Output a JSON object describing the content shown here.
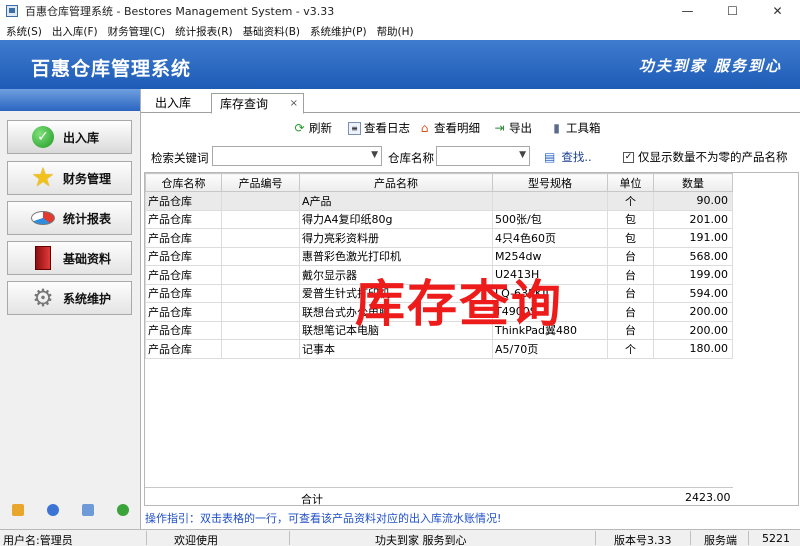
{
  "window": {
    "title": "百惠仓库管理系统 - Bestores Management System - v3.33",
    "minimize": "—",
    "maximize": "☐",
    "close": "✕"
  },
  "menu": [
    "系统(S)",
    "出入库(F)",
    "财务管理(C)",
    "统计报表(R)",
    "基础资料(B)",
    "系统维护(P)",
    "帮助(H)"
  ],
  "banner": {
    "title": "百惠仓库管理系统",
    "slogan": "功夫到家 服务到心"
  },
  "nav": [
    {
      "label": "出入库",
      "icon": "check-icon"
    },
    {
      "label": "财务管理",
      "icon": "star-icon"
    },
    {
      "label": "统计报表",
      "icon": "pie-chart-icon"
    },
    {
      "label": "基础资料",
      "icon": "book-icon"
    },
    {
      "label": "系统维护",
      "icon": "gear-icon"
    }
  ],
  "tabs": {
    "inactive": "出入库",
    "active": "库存查询",
    "close": "×"
  },
  "toolbar": {
    "refresh": "刷新",
    "view_log": "查看日志",
    "view_detail": "查看明细",
    "export": "导出",
    "toolbox": "工具箱"
  },
  "search": {
    "keyword_label": "检索关键词",
    "keyword_value": "",
    "warehouse_label": "仓库名称",
    "warehouse_value": "",
    "find": "查找..",
    "nonzero_label": "仅显示数量不为零的产品名称",
    "nonzero_checked": "✓"
  },
  "table": {
    "headers": [
      "仓库名称",
      "产品编号",
      "产品名称",
      "型号规格",
      "单位",
      "数量"
    ],
    "rows": [
      [
        "产品仓库",
        "",
        "A产品",
        "",
        "个",
        "90.00"
      ],
      [
        "产品仓库",
        "",
        "得力A4复印纸80g",
        "500张/包",
        "包",
        "201.00"
      ],
      [
        "产品仓库",
        "",
        "得力亮彩资料册",
        "4只4色60页",
        "包",
        "191.00"
      ],
      [
        "产品仓库",
        "",
        "惠普彩色激光打印机",
        "M254dw",
        "台",
        "568.00"
      ],
      [
        "产品仓库",
        "",
        "戴尔显示器",
        "U2413H",
        "台",
        "199.00"
      ],
      [
        "产品仓库",
        "",
        "爱普生针式打印机",
        "LQ-635KII",
        "台",
        "594.00"
      ],
      [
        "产品仓库",
        "",
        "联想台式办公电脑",
        "T4900S",
        "台",
        "200.00"
      ],
      [
        "产品仓库",
        "",
        "联想笔记本电脑",
        "ThinkPad翼480",
        "台",
        "200.00"
      ],
      [
        "产品仓库",
        "",
        "记事本",
        "A5/70页",
        "个",
        "180.00"
      ]
    ],
    "total_label": "合计",
    "total_value": "2423.00"
  },
  "watermark": "库存查询",
  "hint": "操作指引：双击表格的一行，可查看该产品资料对应的出入库流水账情况!",
  "status": {
    "user": "用户名:管理员",
    "welcome": "欢迎使用",
    "slogan": "功夫到家 服务到心",
    "version": "版本号3.33",
    "mode": "服务端",
    "code": "5221"
  },
  "colors": {
    "banner": "#1d5bb6",
    "watermark": "#ee1b1b",
    "hint": "#1f4fc8"
  }
}
